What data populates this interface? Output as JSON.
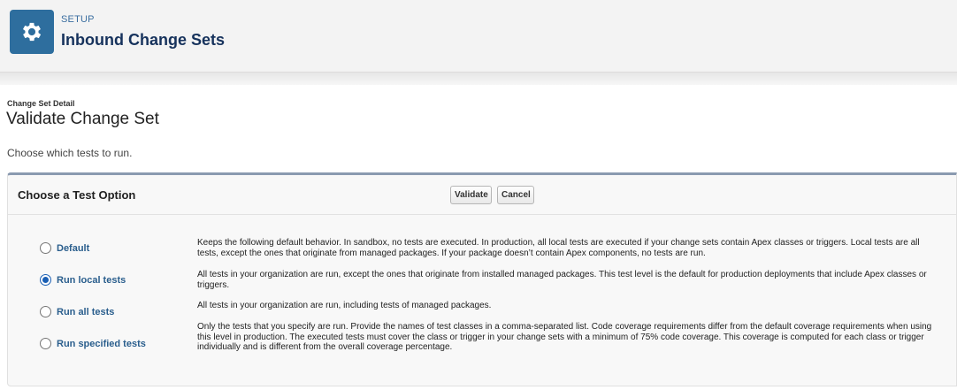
{
  "header": {
    "eyebrow": "SETUP",
    "title": "Inbound Change Sets",
    "icon": "gear-icon"
  },
  "page": {
    "breadcrumb": "Change Set Detail",
    "title": "Validate Change Set",
    "instructions": "Choose which tests to run."
  },
  "panel": {
    "title": "Choose a Test Option",
    "validate_label": "Validate",
    "cancel_label": "Cancel"
  },
  "options": [
    {
      "label": "Default",
      "selected": false,
      "description": "Keeps the following default behavior. In sandbox, no tests are executed. In production, all local tests are executed if your change sets contain Apex classes or triggers. Local tests are all tests, except the ones that originate from managed packages. If your package doesn’t contain Apex components, no tests are run."
    },
    {
      "label": "Run local tests",
      "selected": true,
      "description": "All tests in your organization are run, except the ones that originate from installed managed packages. This test level is the default for production deployments that include Apex classes or triggers."
    },
    {
      "label": "Run all tests",
      "selected": false,
      "description": "All tests in your organization are run, including tests of managed packages."
    },
    {
      "label": "Run specified tests",
      "selected": false,
      "description": "Only the tests that you specify are run. Provide the names of test classes in a comma-separated list. Code coverage requirements differ from the default coverage requirements when using this level in production. The executed tests must cover the class or trigger in your change sets with a minimum of 75% code coverage. This coverage is computed for each class or trigger individually and is different from the overall coverage percentage."
    }
  ],
  "colors": {
    "brand": "#2e6e9e",
    "link": "#2a5e8d",
    "radio_selected": "#1a5fb4"
  }
}
